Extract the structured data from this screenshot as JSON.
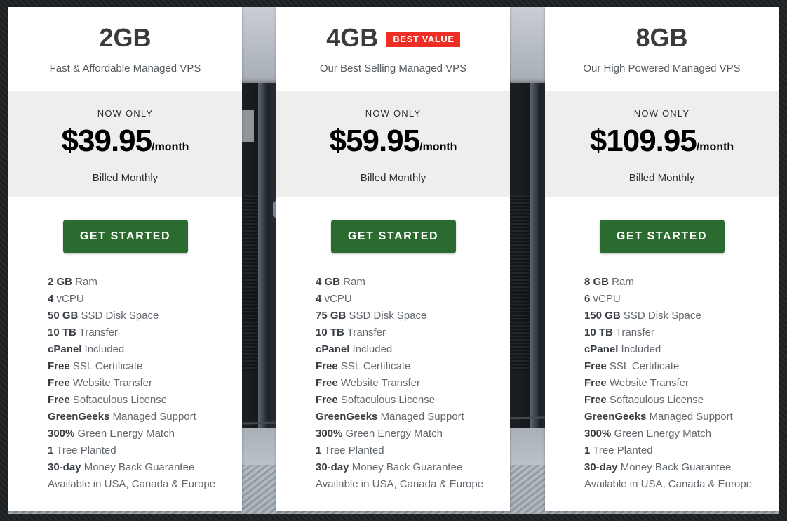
{
  "plans": [
    {
      "title": "2GB",
      "badge": null,
      "subtitle": "Fast & Affordable Managed VPS",
      "now_only_label": "NOW ONLY",
      "price": "$39.95",
      "period": "/month",
      "billing_note": "Billed Monthly",
      "cta_label": "GET STARTED",
      "features": [
        {
          "strong": "2 GB",
          "rest": " Ram"
        },
        {
          "strong": "4",
          "rest": " vCPU"
        },
        {
          "strong": "50 GB",
          "rest": " SSD Disk Space"
        },
        {
          "strong": "10 TB",
          "rest": " Transfer"
        },
        {
          "strong": "cPanel",
          "rest": " Included"
        },
        {
          "strong": "Free",
          "rest": " SSL Certificate"
        },
        {
          "strong": "Free",
          "rest": " Website Transfer"
        },
        {
          "strong": "Free",
          "rest": " Softaculous License"
        },
        {
          "strong": "GreenGeeks",
          "rest": " Managed Support"
        },
        {
          "strong": "300%",
          "rest": " Green Energy Match"
        },
        {
          "strong": "1",
          "rest": " Tree Planted"
        },
        {
          "strong": "30-day",
          "rest": " Money Back Guarantee"
        },
        {
          "strong": "",
          "rest": "Available in USA, Canada & Europe"
        }
      ]
    },
    {
      "title": "4GB",
      "badge": "BEST VALUE",
      "subtitle": "Our Best Selling Managed VPS",
      "now_only_label": "NOW ONLY",
      "price": "$59.95",
      "period": "/month",
      "billing_note": "Billed Monthly",
      "cta_label": "GET STARTED",
      "features": [
        {
          "strong": "4 GB",
          "rest": " Ram"
        },
        {
          "strong": "4",
          "rest": " vCPU"
        },
        {
          "strong": "75 GB",
          "rest": " SSD Disk Space"
        },
        {
          "strong": "10 TB",
          "rest": " Transfer"
        },
        {
          "strong": "cPanel",
          "rest": " Included"
        },
        {
          "strong": "Free",
          "rest": " SSL Certificate"
        },
        {
          "strong": "Free",
          "rest": " Website Transfer"
        },
        {
          "strong": "Free",
          "rest": " Softaculous License"
        },
        {
          "strong": "GreenGeeks",
          "rest": " Managed Support"
        },
        {
          "strong": "300%",
          "rest": " Green Energy Match"
        },
        {
          "strong": "1",
          "rest": " Tree Planted"
        },
        {
          "strong": "30-day",
          "rest": " Money Back Guarantee"
        },
        {
          "strong": "",
          "rest": "Available in USA, Canada & Europe"
        }
      ]
    },
    {
      "title": "8GB",
      "badge": null,
      "subtitle": "Our High Powered Managed VPS",
      "now_only_label": "NOW ONLY",
      "price": "$109.95",
      "period": "/month",
      "billing_note": "Billed Monthly",
      "cta_label": "GET STARTED",
      "features": [
        {
          "strong": "8 GB",
          "rest": " Ram"
        },
        {
          "strong": "6",
          "rest": " vCPU"
        },
        {
          "strong": "150 GB",
          "rest": " SSD Disk Space"
        },
        {
          "strong": "10 TB",
          "rest": " Transfer"
        },
        {
          "strong": "cPanel",
          "rest": " Included"
        },
        {
          "strong": "Free",
          "rest": " SSL Certificate"
        },
        {
          "strong": "Free",
          "rest": " Website Transfer"
        },
        {
          "strong": "Free",
          "rest": " Softaculous License"
        },
        {
          "strong": "GreenGeeks",
          "rest": " Managed Support"
        },
        {
          "strong": "300%",
          "rest": " Green Energy Match"
        },
        {
          "strong": "1",
          "rest": " Tree Planted"
        },
        {
          "strong": "30-day",
          "rest": " Money Back Guarantee"
        },
        {
          "strong": "",
          "rest": "Available in USA, Canada & Europe"
        }
      ]
    }
  ],
  "colors": {
    "cta_green": "#2c6b2f",
    "badge_red": "#ee2d24",
    "price_band": "#eeeeee",
    "title_grey": "#3b3b3b",
    "feature_grey": "#62686d"
  },
  "background": {
    "description": "data center server racks photo"
  }
}
